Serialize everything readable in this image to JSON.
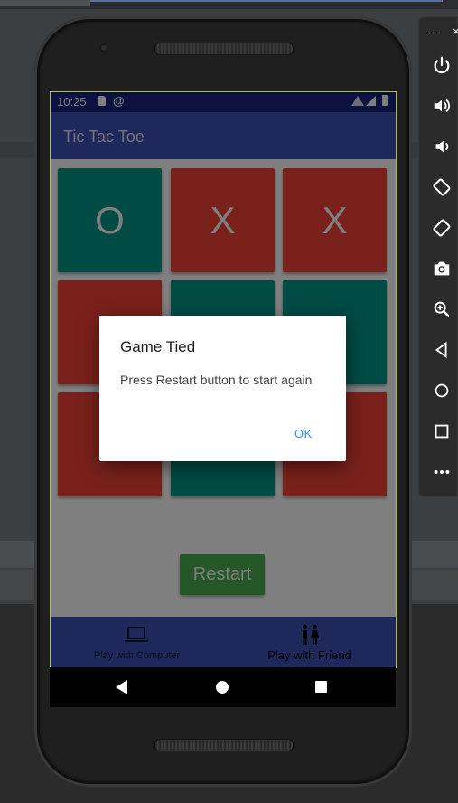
{
  "status_bar": {
    "time": "10:25"
  },
  "app": {
    "title": "Tic Tac Toe"
  },
  "board": {
    "cells": [
      "O",
      "X",
      "X",
      "",
      "",
      "",
      "",
      "",
      ""
    ]
  },
  "restart_label": "Restart",
  "bottom_nav": {
    "left_label": "Play with Computer",
    "right_label": "Play with Friend"
  },
  "dialog": {
    "title": "Game Tied",
    "message": "Press Restart button to start again",
    "ok_label": "OK"
  },
  "emulator_panel": {
    "minimize": "–",
    "close": "×",
    "buttons": [
      "power-icon",
      "volume-up-icon",
      "volume-down-icon",
      "rotate-left-icon",
      "rotate-right-icon",
      "camera-icon",
      "zoom-icon",
      "back-icon",
      "home-icon",
      "overview-icon",
      "more-icon"
    ]
  },
  "colors": {
    "primary": "#3f51b5",
    "status": "#1a237e",
    "cell_o": "#009688",
    "cell_x": "#f44336",
    "restart": "#4caf50",
    "dialog_ok": "#2196f3"
  }
}
